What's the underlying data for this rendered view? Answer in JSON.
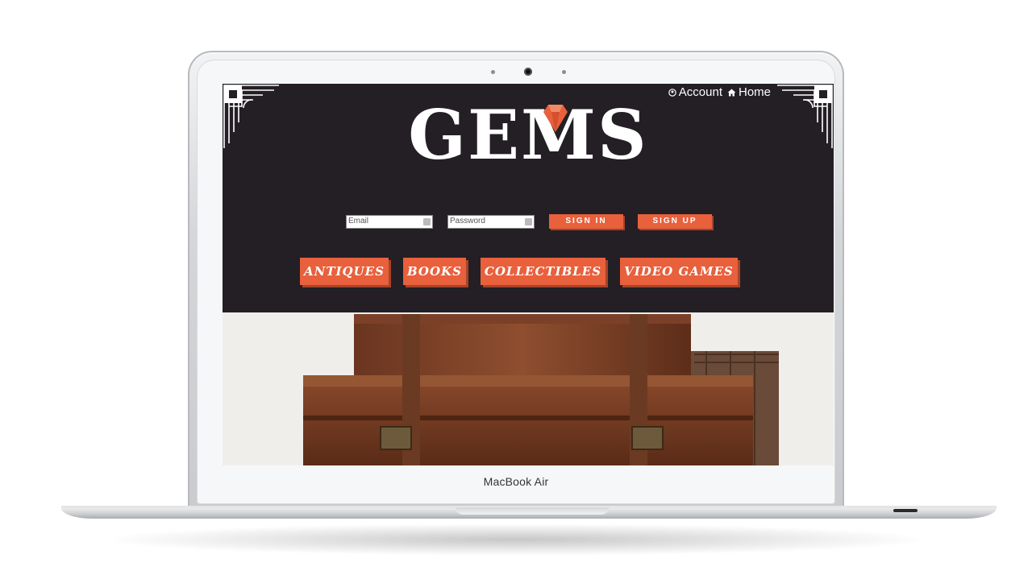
{
  "device": {
    "model_label": "MacBook Air"
  },
  "site": {
    "top_nav": {
      "account_label": "Account",
      "home_label": "Home"
    },
    "logo": {
      "text_left": "GE",
      "text_right": "MS",
      "gem_color": "#e8603c"
    },
    "auth": {
      "email_placeholder": "Email",
      "password_placeholder": "Password",
      "sign_in_label": "SIGN IN",
      "sign_up_label": "SIGN UP"
    },
    "categories": [
      {
        "label": "ANTIQUES"
      },
      {
        "label": "BOOKS"
      },
      {
        "label": "COLLECTIBLES"
      },
      {
        "label": "VIDEO GAMES"
      }
    ],
    "colors": {
      "header_bg": "#231f24",
      "accent": "#e8603c",
      "accent_shadow": "#a8432a"
    }
  }
}
